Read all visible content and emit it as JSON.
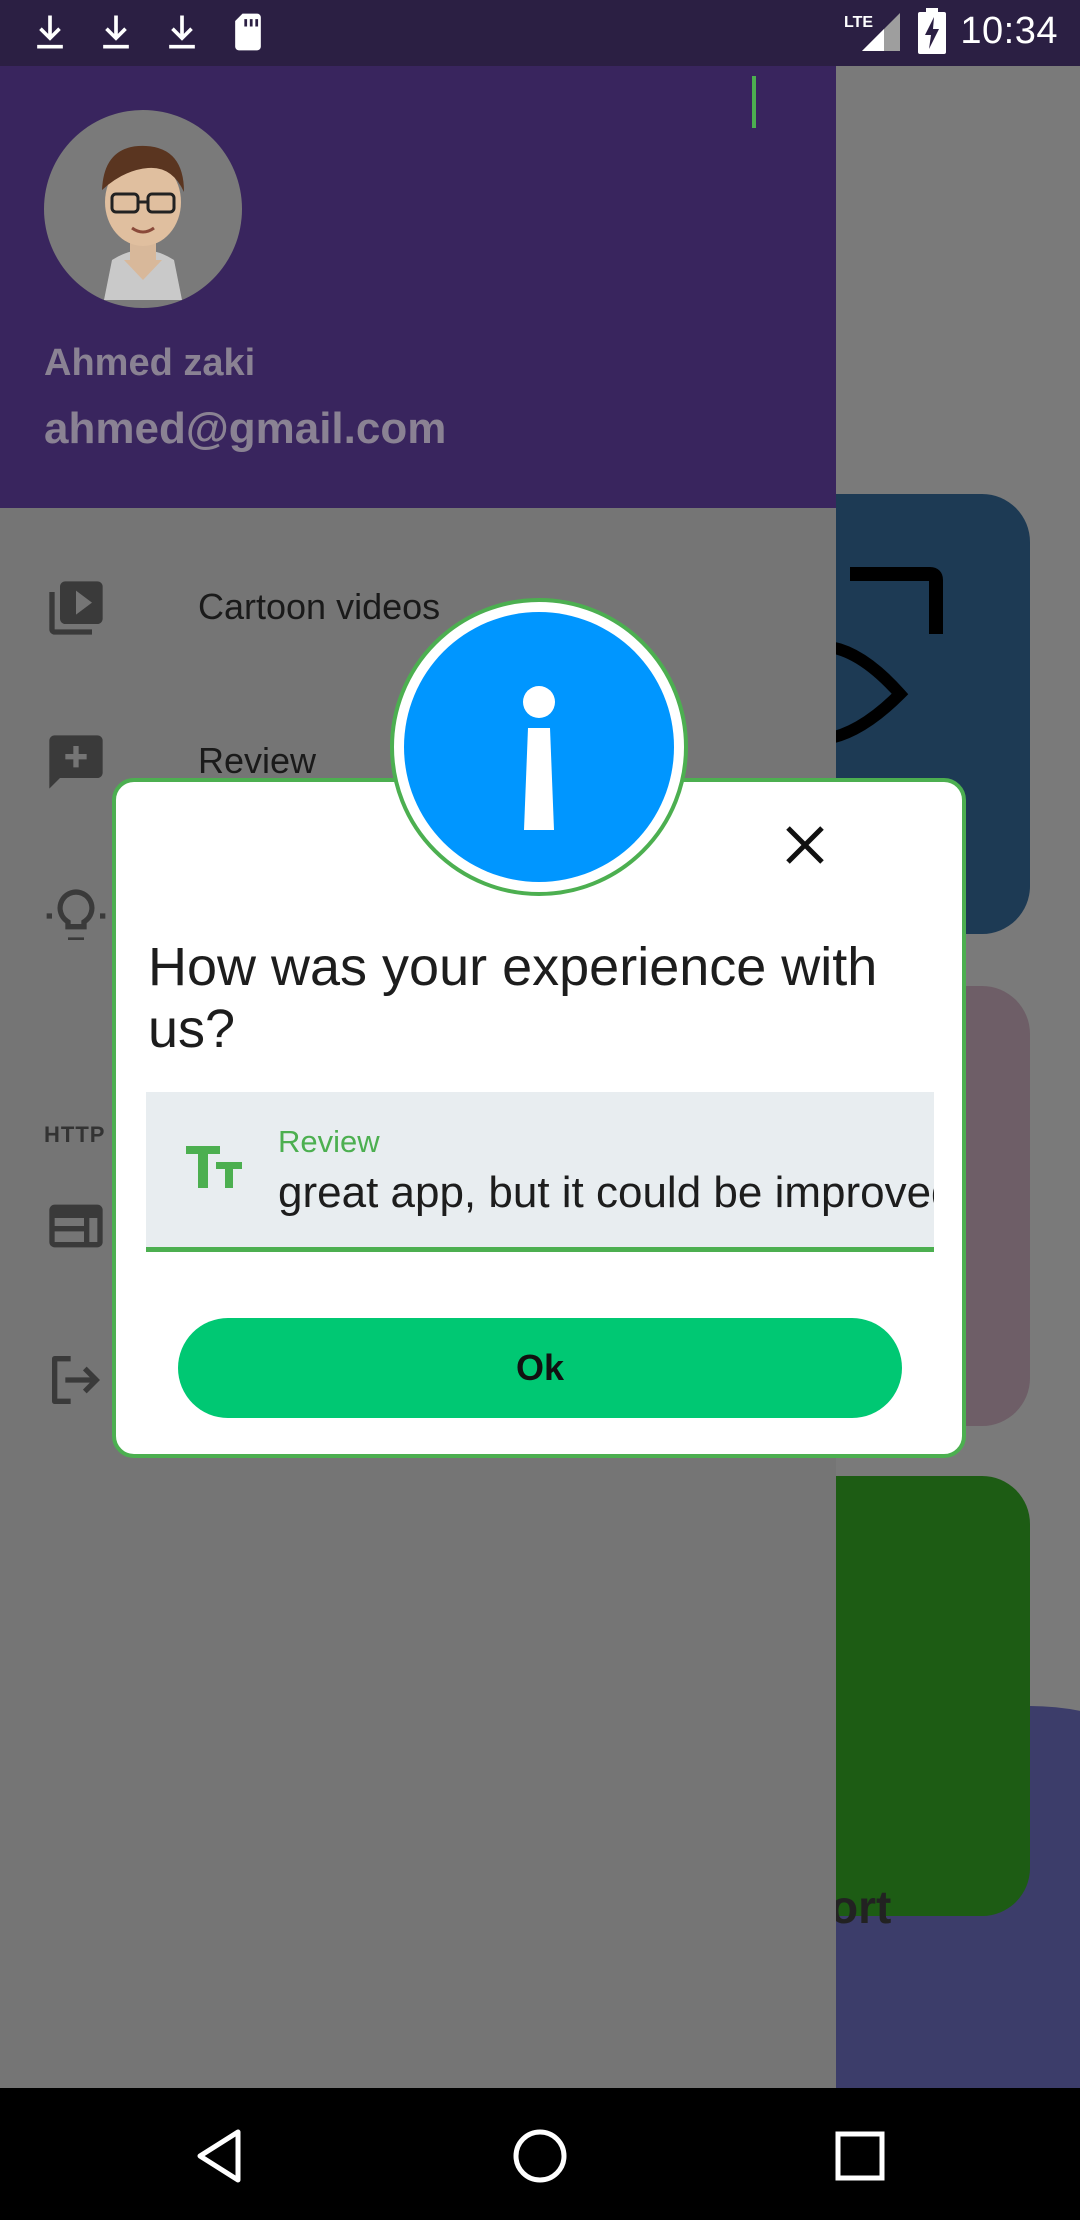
{
  "status_bar": {
    "time": "10:34",
    "network": "LTE",
    "icons": [
      "download-icon",
      "download-icon",
      "download-icon",
      "sd-card-icon",
      "signal-icon",
      "battery-charging-icon"
    ]
  },
  "drawer": {
    "user": {
      "name": "Ahmed zaki",
      "email": "ahmed@gmail.com"
    },
    "items": [
      {
        "label": "Cartoon videos",
        "icon": "video-library-icon"
      },
      {
        "label": "Review",
        "icon": "review-icon"
      },
      {
        "label": "",
        "icon": "lightbulb-icon"
      },
      {
        "label": "",
        "icon": "http-icon",
        "badge": "HTTP"
      },
      {
        "label": "",
        "icon": "web-icon"
      },
      {
        "label": "",
        "icon": "logout-icon"
      }
    ]
  },
  "background": {
    "card_3_label": "ort"
  },
  "dialog": {
    "title": "How was your experience with us?",
    "field": {
      "label": "Review",
      "value": "great app, but it could be improved"
    },
    "ok_label": "Ok",
    "icons": {
      "badge": "info-icon",
      "close": "close-icon",
      "field": "text-format-icon"
    }
  },
  "nav_bar": {
    "buttons": [
      "back-icon",
      "home-icon",
      "recents-icon"
    ]
  },
  "colors": {
    "drawer_header": "#39255e",
    "accent_green": "#4caf50",
    "ok_button": "#00c873",
    "info_blue": "#0096ff"
  }
}
